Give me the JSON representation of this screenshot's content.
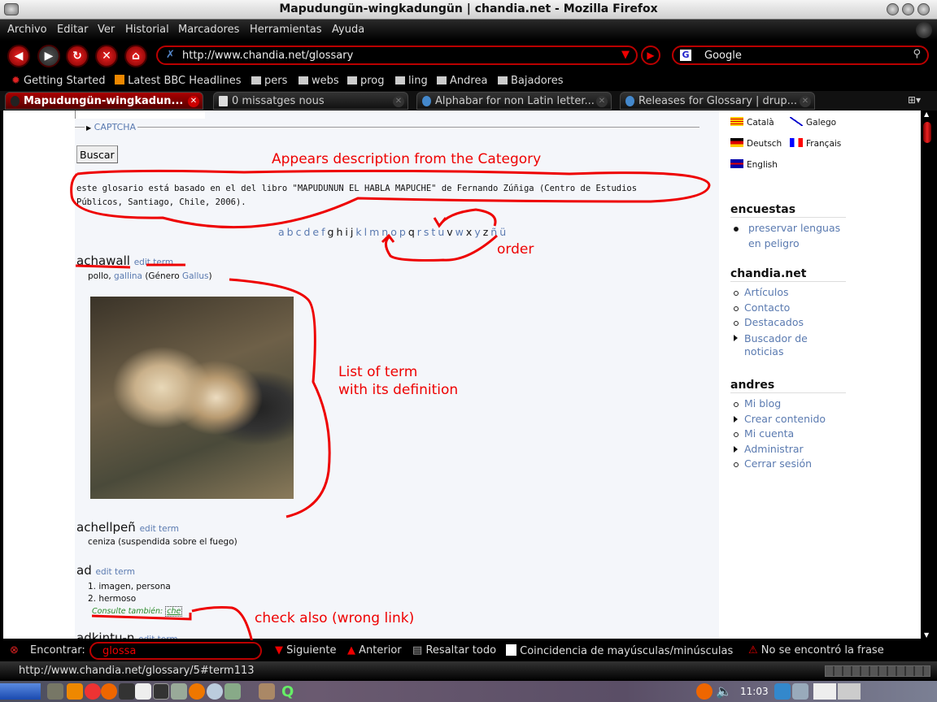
{
  "window": {
    "title": "Mapudungün-wingkadungün | chandia.net - Mozilla Firefox"
  },
  "menu": [
    "Archivo",
    "Editar",
    "Ver",
    "Historial",
    "Marcadores",
    "Herramientas",
    "Ayuda"
  ],
  "nav": {
    "url": "http://www.chandia.net/glossary",
    "search_engine": "Google"
  },
  "bookmarks": [
    "Getting Started",
    "Latest BBC Headlines",
    "pers",
    "webs",
    "prog",
    "ling",
    "Andrea",
    "Bajadores"
  ],
  "tabs": [
    {
      "label": "Mapudungün-wingkadun...",
      "active": true
    },
    {
      "label": "0 missatges nous"
    },
    {
      "label": "Alphabar for non Latin letter..."
    },
    {
      "label": "Releases for Glossary | drup..."
    }
  ],
  "page": {
    "captcha": "CAPTCHA",
    "search_button": "Buscar",
    "description_line1": "este glosario está basado en el del libro \"MAPUDUNUN EL HABLA MAPUCHE\" de Fernando Zúñiga (Centro de Estudios",
    "description_line2": "Públicos, Santiago, Chile, 2006).",
    "alphabet": [
      {
        "l": "a",
        "link": true
      },
      {
        "l": "b",
        "link": true
      },
      {
        "l": "c",
        "link": true
      },
      {
        "l": "d",
        "link": true
      },
      {
        "l": "e",
        "link": true
      },
      {
        "l": "f",
        "link": true
      },
      {
        "l": "g",
        "link": false
      },
      {
        "l": "h",
        "link": false
      },
      {
        "l": "i",
        "link": false
      },
      {
        "l": "j",
        "link": false
      },
      {
        "l": "k",
        "link": true
      },
      {
        "l": "l",
        "link": true
      },
      {
        "l": "m",
        "link": true
      },
      {
        "l": "n",
        "link": true
      },
      {
        "l": "o",
        "link": true
      },
      {
        "l": "p",
        "link": true
      },
      {
        "l": "q",
        "link": false
      },
      {
        "l": "r",
        "link": true
      },
      {
        "l": "s",
        "link": true
      },
      {
        "l": "t",
        "link": true
      },
      {
        "l": "u",
        "link": true
      },
      {
        "l": "v",
        "link": false
      },
      {
        "l": "w",
        "link": true
      },
      {
        "l": "x",
        "link": false
      },
      {
        "l": "y",
        "link": true
      },
      {
        "l": "z",
        "link": false
      },
      {
        "l": "ñ",
        "link": true
      },
      {
        "l": "ü",
        "link": true
      }
    ],
    "edit_term": "edit term",
    "terms": [
      {
        "term": "achawall",
        "def_parts": [
          "pollo, ",
          "gallina",
          " (Género ",
          "Gallus",
          ")"
        ]
      },
      {
        "term": "achellpeñ",
        "def": "ceniza (suspendida sobre el fuego)"
      },
      {
        "term": "ad",
        "defs": [
          "1. imagen, persona",
          "2. hermoso"
        ],
        "see_also_label": "Consulte también:",
        "see_also_link": "che"
      },
      {
        "term": "adkintu-n"
      }
    ]
  },
  "sidebar": {
    "languages": [
      "Català",
      "Galego",
      "Deutsch",
      "Français",
      "English"
    ],
    "blocks": [
      {
        "title": "encuestas",
        "items": [
          "preservar lenguas en peligro"
        ]
      },
      {
        "title": "chandia.net",
        "items": [
          "Artículos",
          "Contacto",
          "Destacados",
          "Buscador de noticias"
        ]
      },
      {
        "title": "andres",
        "items": [
          "Mi blog",
          "Crear contenido",
          "Mi cuenta",
          "Administrar",
          "Cerrar sesión"
        ]
      }
    ]
  },
  "annotations": {
    "description": "Appears description from the Category",
    "order": "order",
    "list": "List of term",
    "list2": "with its definition",
    "check": "check also (wrong link)"
  },
  "findbar": {
    "label": "Encontrar:",
    "value": "glossa",
    "next": "Siguiente",
    "prev": "Anterior",
    "highlight": "Resaltar todo",
    "match_case": "Coincidencia de mayúsculas/minúsculas",
    "status": "No se encontró la frase"
  },
  "statusbar": {
    "url": "http://www.chandia.net/glossary/5#term113"
  },
  "taskbar": {
    "clock": "11:03"
  }
}
